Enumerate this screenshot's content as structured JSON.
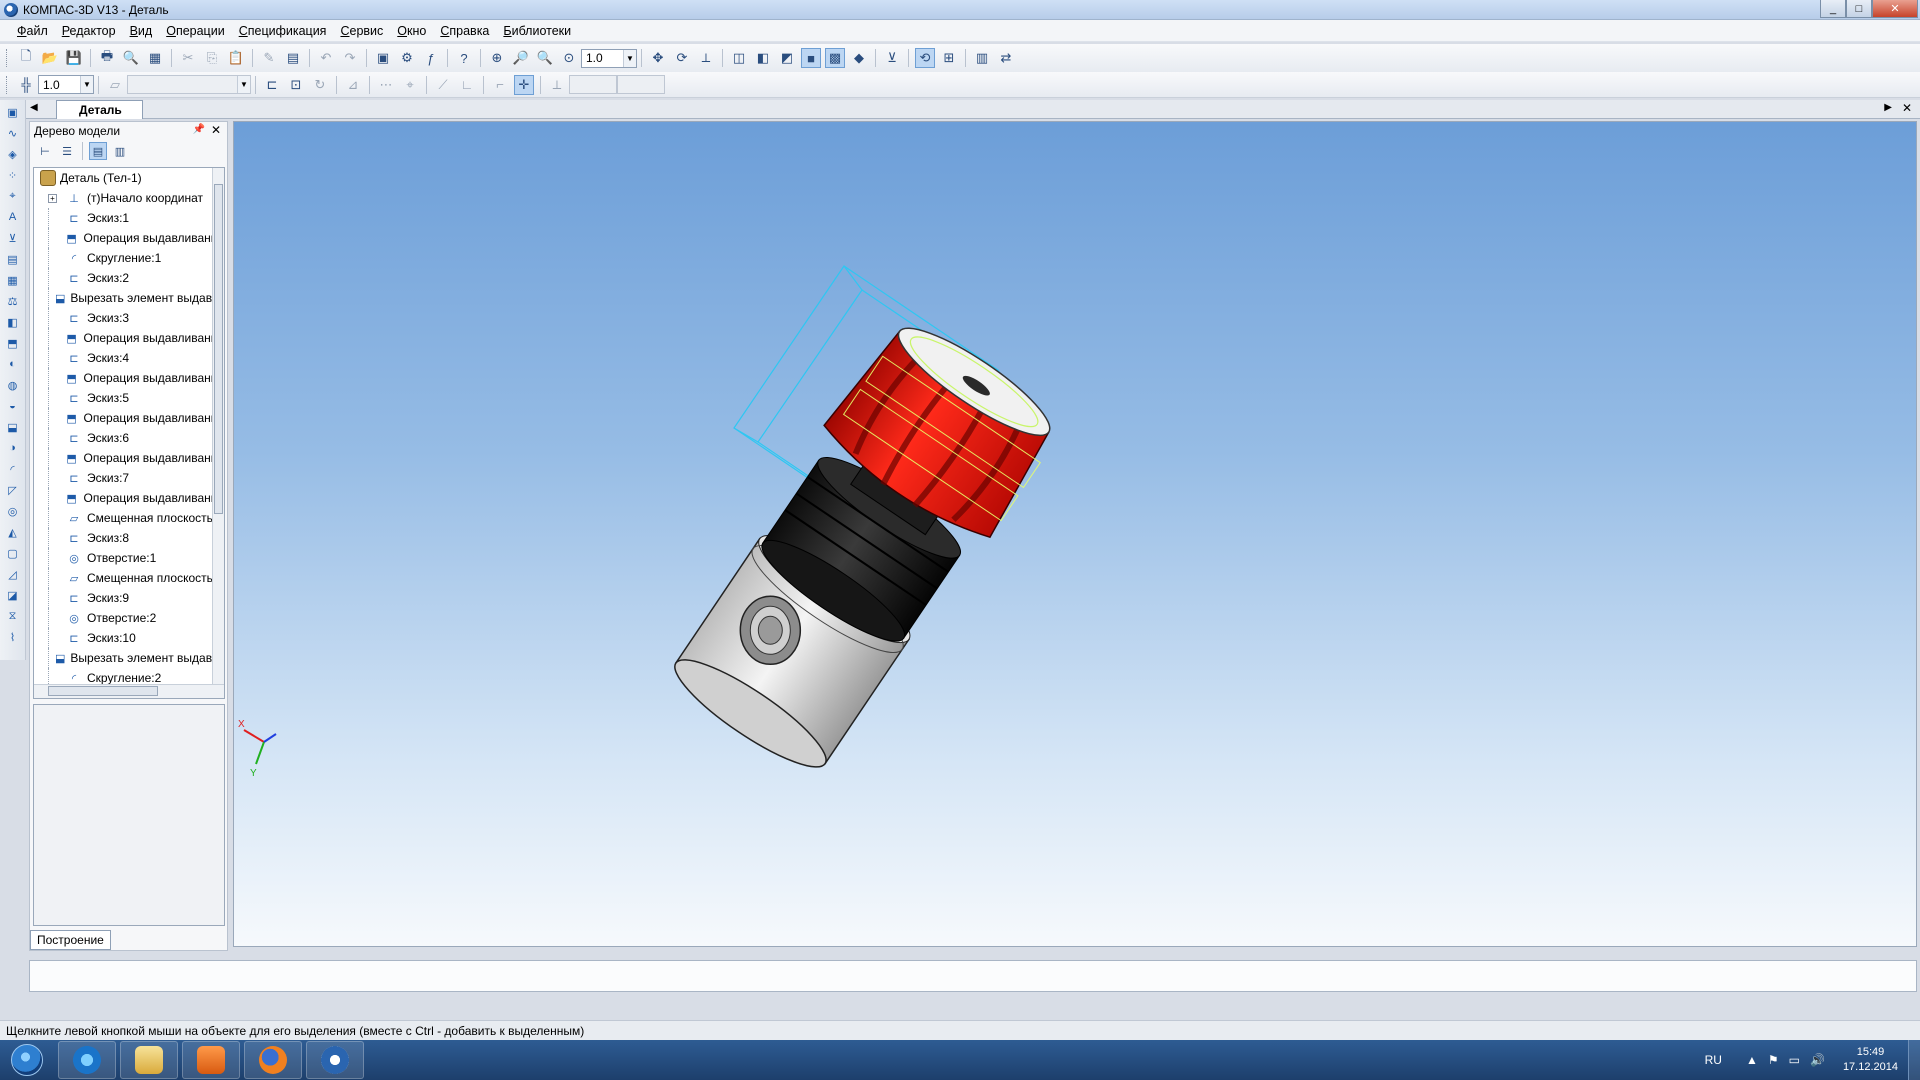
{
  "window": {
    "title": "КОМПАС-3D V13 - Деталь",
    "minimize": "_",
    "maximize": "□",
    "close": "✕"
  },
  "menu": [
    "Файл",
    "Редактор",
    "Вид",
    "Операции",
    "Спецификация",
    "Сервис",
    "Окно",
    "Справка",
    "Библиотеки"
  ],
  "toolbar": {
    "zoom_value": "1.0",
    "step_value": "1.0",
    "layer_value": ""
  },
  "document_tab": {
    "label": "Деталь"
  },
  "model_tree": {
    "title": "Дерево модели",
    "root": "Деталь (Тел-1)",
    "items": [
      {
        "label": "(т)Начало координат",
        "icon": "axes-icon",
        "expandable": true
      },
      {
        "label": "Эскиз:1",
        "icon": "sketch-icon"
      },
      {
        "label": "Операция выдавливания",
        "icon": "extrude-icon"
      },
      {
        "label": "Скругление:1",
        "icon": "fillet-icon"
      },
      {
        "label": "Эскиз:2",
        "icon": "sketch-icon"
      },
      {
        "label": "Вырезать элемент выдавливания",
        "icon": "cut-icon"
      },
      {
        "label": "Эскиз:3",
        "icon": "sketch-icon"
      },
      {
        "label": "Операция выдавливания",
        "icon": "extrude-icon"
      },
      {
        "label": "Эскиз:4",
        "icon": "sketch-icon"
      },
      {
        "label": "Операция выдавливания",
        "icon": "extrude-icon"
      },
      {
        "label": "Эскиз:5",
        "icon": "sketch-icon"
      },
      {
        "label": "Операция выдавливания",
        "icon": "extrude-icon"
      },
      {
        "label": "Эскиз:6",
        "icon": "sketch-icon"
      },
      {
        "label": "Операция выдавливания",
        "icon": "extrude-icon"
      },
      {
        "label": "Эскиз:7",
        "icon": "sketch-icon"
      },
      {
        "label": "Операция выдавливания",
        "icon": "extrude-icon"
      },
      {
        "label": "Смещенная плоскость",
        "icon": "plane-icon"
      },
      {
        "label": "Эскиз:8",
        "icon": "sketch-icon"
      },
      {
        "label": "Отверстие:1",
        "icon": "hole-icon"
      },
      {
        "label": "Смещенная плоскость",
        "icon": "plane-icon"
      },
      {
        "label": "Эскиз:9",
        "icon": "sketch-icon"
      },
      {
        "label": "Отверстие:2",
        "icon": "hole-icon"
      },
      {
        "label": "Эскиз:10",
        "icon": "sketch-icon"
      },
      {
        "label": "Вырезать элемент выдавливания",
        "icon": "cut-icon"
      },
      {
        "label": "Скругление:2",
        "icon": "fillet-icon"
      }
    ],
    "bottom_tab": "Построение"
  },
  "viewport": {
    "axis_x": "X",
    "axis_y": "Y",
    "colors": {
      "knob": "#e8140c",
      "collar": "#1b1b1b",
      "body": "#d9d9d9",
      "bbox": "#2ec7f2"
    }
  },
  "status": {
    "hint": "Щелкните левой кнопкой мыши на объекте для его выделения (вместе с Ctrl - добавить к выделенным)"
  },
  "taskbar": {
    "lang": "RU",
    "time": "15:49",
    "date": "17.12.2014",
    "apps": [
      "internet-explorer",
      "file-explorer",
      "media-player",
      "firefox",
      "kompas"
    ]
  }
}
